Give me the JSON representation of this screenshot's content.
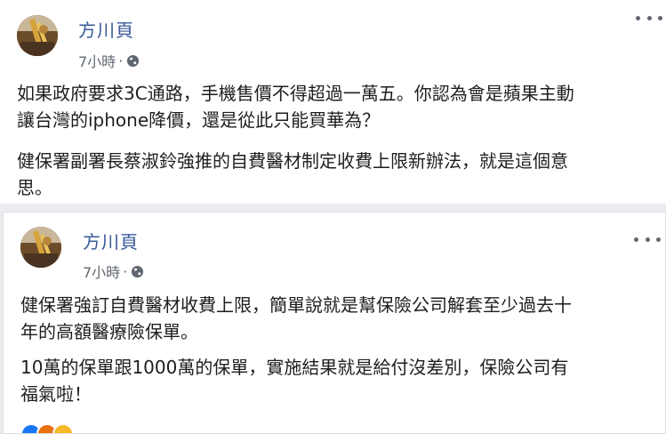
{
  "posts": [
    {
      "author": "方川頁",
      "time": "7小時",
      "separator": "·",
      "privacy_icon": "globe-icon",
      "more_icon": "more-options-icon",
      "paragraphs": [
        "如果政府要求3C通路，手機售價不得超過一萬五。你認為會是蘋果主動\n讓台灣的iphone降價，還是從此只能買華為？",
        "健保署副署長蔡淑鈴強推的自費醫材制定收費上限新辦法，就是這個意\n思。"
      ]
    },
    {
      "author": "方川頁",
      "time": "7小時",
      "separator": "·",
      "privacy_icon": "globe-icon",
      "more_icon": "more-options-icon",
      "paragraphs": [
        "健保署強訂自費醫材收費上限，簡單說就是幫保險公司解套至少過去十\n年的高額醫療險保單。",
        "10萬的保單跟1000萬的保單，實施結果就是給付沒差別，保險公司有\n福氣啦！"
      ],
      "reactions": [
        "like",
        "angry",
        "haha"
      ]
    }
  ],
  "colors": {
    "author": "#385898",
    "meta": "#606770",
    "text": "#1c1e21",
    "background": "#e9ebee"
  }
}
